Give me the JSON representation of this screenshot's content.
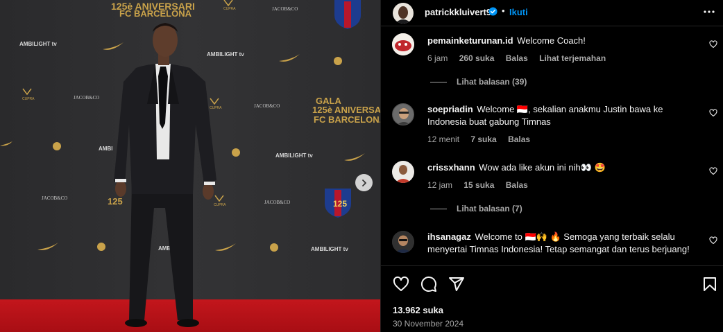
{
  "media": {
    "backdrop_texts": [
      "GALA",
      "125è ANIVERSARI",
      "FC BARCELONA",
      "AMBILIGHT tv",
      "JACOB&CO",
      "CUPRA"
    ],
    "next_icon": "chevron-right-icon"
  },
  "header": {
    "username": "patrickkluivert9",
    "dot": "•",
    "follow_label": "Ikuti",
    "verified_icon": "verified-badge-icon",
    "more_icon": "more-options-icon"
  },
  "comments": [
    {
      "username": "pemainketurunan.id",
      "text": "Welcome Coach!",
      "meta": {
        "time": "6 jam",
        "likes": "260 suka",
        "reply": "Balas",
        "translate": "Lihat terjemahan"
      },
      "replies_label": "Lihat balasan (39)"
    },
    {
      "username": "soepriadin",
      "text": "Welcome 🇮🇩, sekalian anakmu Justin bawa ke Indonesia buat gabung Timnas",
      "meta": {
        "time": "12 menit",
        "likes": "7 suka",
        "reply": "Balas"
      }
    },
    {
      "username": "crissxhann",
      "text": "Wow ada like akun ini nih👀 🤩",
      "meta": {
        "time": "12 jam",
        "likes": "15 suka",
        "reply": "Balas"
      },
      "replies_label": "Lihat balasan (7)"
    },
    {
      "username": "ihsanagaz",
      "text": "Welcome to 🇮🇩🙌 🔥 Semoga yang terbaik selalu menyertai Timnas Indonesia! Tetap semangat dan terus berjuang!"
    }
  ],
  "actions": {
    "like_icon": "heart-icon",
    "comment_icon": "comment-icon",
    "share_icon": "share-icon",
    "save_icon": "bookmark-icon",
    "likes": "13.962 suka",
    "date": "30 November 2024"
  },
  "colors": {
    "background": "#000000",
    "text": "#f5f5f5",
    "muted": "#a8a8a8",
    "link": "#0095f6",
    "divider": "#262626"
  }
}
